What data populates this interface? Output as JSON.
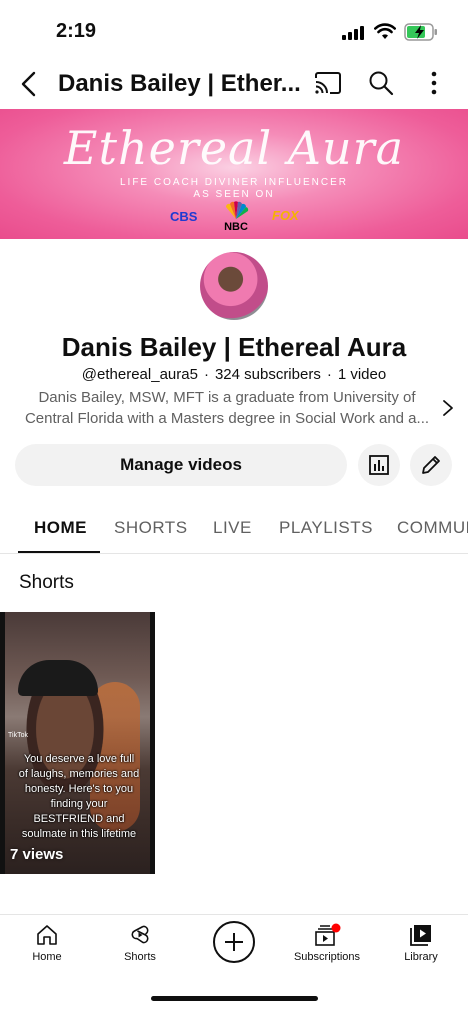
{
  "status_bar": {
    "time": "2:19"
  },
  "app_bar": {
    "title": "Danis Bailey | Ether...",
    "icons": [
      "back-icon",
      "cast-icon",
      "search-icon",
      "more-icon"
    ]
  },
  "banner": {
    "script_title": "Ethereal Aura",
    "tagline1": "LIFE COACH DIVINER INFLUENCER",
    "tagline2": "AS SEEN ON",
    "logo_cbs": "CBS",
    "logo_nbc": "NBC",
    "logo_fox": "FOX"
  },
  "channel": {
    "name": "Danis Bailey | Ethereal Aura",
    "handle": "@ethereal_aura5",
    "subscribers": "324 subscribers",
    "videos": "1 video",
    "separator": "·",
    "description_line1": "Danis Bailey, MSW, MFT is a graduate from University of",
    "description_line2": "Central Florida with a Masters degree in Social Work and a..."
  },
  "actions": {
    "manage_label": "Manage videos"
  },
  "tabs": [
    {
      "label": "HOME",
      "active": true
    },
    {
      "label": "SHORTS",
      "active": false
    },
    {
      "label": "LIVE",
      "active": false
    },
    {
      "label": "PLAYLISTS",
      "active": false
    },
    {
      "label": "COMMUNI",
      "active": false
    }
  ],
  "shorts_section": {
    "title": "Shorts",
    "items": [
      {
        "caption": "You deserve a love full of laughs, memories and honesty. Here's to you finding your BESTFRIEND and soulmate in this lifetime",
        "watermark": "TikTok",
        "views": "7 views"
      }
    ]
  },
  "bottom_nav": [
    {
      "label": "Home",
      "icon": "home-icon"
    },
    {
      "label": "Shorts",
      "icon": "shorts-icon"
    },
    {
      "label": "",
      "icon": "create-icon"
    },
    {
      "label": "Subscriptions",
      "icon": "subscriptions-icon"
    },
    {
      "label": "Library",
      "icon": "library-icon"
    }
  ],
  "colors": {
    "accent_red": "#ff0000",
    "text_primary": "#0f0f0f",
    "text_secondary": "#606060",
    "chip_bg": "#f2f2f2"
  }
}
